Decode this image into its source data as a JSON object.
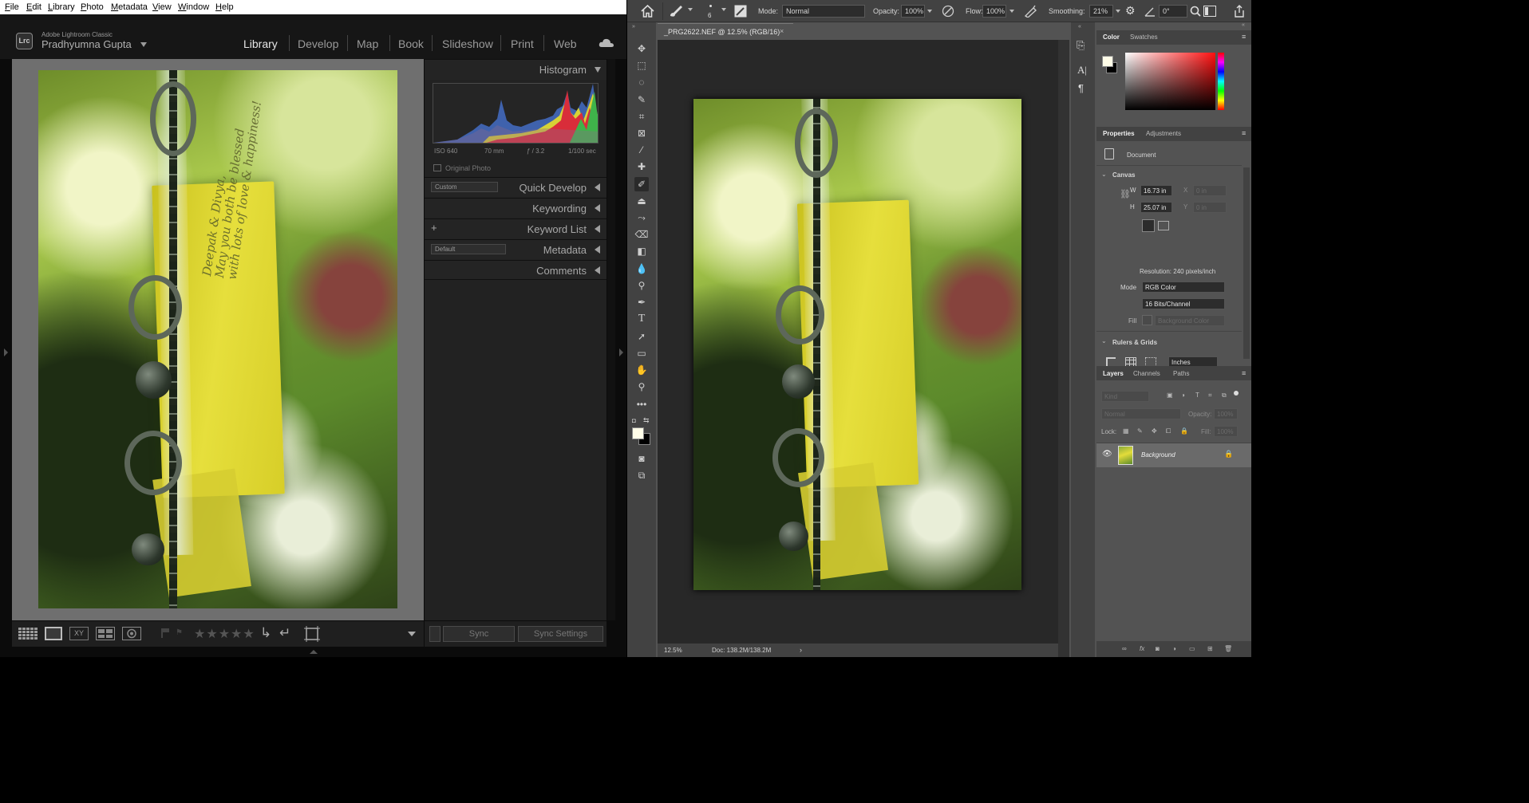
{
  "lightroom": {
    "menu": [
      "File",
      "Edit",
      "Library",
      "Photo",
      "Metadata",
      "View",
      "Window",
      "Help"
    ],
    "app_name": "Adobe Lightroom Classic",
    "user_name": "Pradhyumna Gupta",
    "logo": "Lrc",
    "modules": [
      "Library",
      "Develop",
      "Map",
      "Book",
      "Slideshow",
      "Print",
      "Web"
    ],
    "active_module": "Library",
    "photo_text": [
      "Deepak & Divya,",
      "May you both be blessed",
      "with lots of love & happiness!"
    ],
    "panels": {
      "histogram": "Histogram",
      "exif": {
        "iso": "ISO 640",
        "focal": "70 mm",
        "aperture": "ƒ / 3.2",
        "shutter": "1/100 sec"
      },
      "original_photo": "Original Photo",
      "quick_develop": "Quick Develop",
      "quick_develop_preset": "Custom",
      "keywording": "Keywording",
      "keyword_list": "Keyword List",
      "metadata": "Metadata",
      "metadata_preset": "Default",
      "comments": "Comments"
    },
    "footer": {
      "sync": "Sync",
      "sync_settings": "Sync Settings",
      "rating": "★★★★★",
      "compare": "XY"
    }
  },
  "photoshop": {
    "options_bar": {
      "mode_label": "Mode:",
      "mode_value": "Normal",
      "opacity_label": "Opacity:",
      "opacity_value": "100%",
      "flow_label": "Flow:",
      "flow_value": "100%",
      "smoothing_label": "Smoothing:",
      "smoothing_value": "21%",
      "angle_value": "0°",
      "brush_size": "6"
    },
    "doc_tab": "_PRG2622.NEF @ 12.5% (RGB/16)",
    "status": {
      "zoom": "12.5%",
      "doc": "Doc: 138.2M/138.2M"
    },
    "color_panel": {
      "tabs": [
        "Color",
        "Swatches"
      ]
    },
    "properties_panel": {
      "tabs": [
        "Properties",
        "Adjustments"
      ],
      "document_label": "Document",
      "canvas_section": "Canvas",
      "w_label": "W",
      "w_value": "16.73 in",
      "h_label": "H",
      "h_value": "25.07 in",
      "x_label": "X",
      "x_value": "0 in",
      "y_label": "Y",
      "y_value": "0 in",
      "resolution": "Resolution: 240 pixels/inch",
      "mode_label": "Mode",
      "mode_value": "RGB Color",
      "bits_value": "16 Bits/Channel",
      "fill_label": "Fill",
      "fill_value": "Background Color",
      "rulers_section": "Rulers & Grids",
      "units_value": "Inches"
    },
    "layers_panel": {
      "tabs": [
        "Layers",
        "Channels",
        "Paths"
      ],
      "kind_placeholder": "Kind",
      "blend_mode": "Normal",
      "opacity_label": "Opacity:",
      "opacity_value": "100%",
      "lock_label": "Lock:",
      "fill_label": "Fill:",
      "fill_value": "100%",
      "layer_name": "Background"
    }
  }
}
